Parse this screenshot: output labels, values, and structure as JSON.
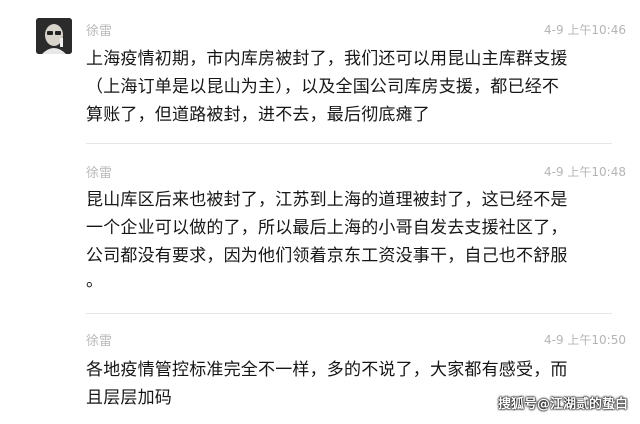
{
  "messages": [
    {
      "name": "徐雷",
      "time": "4-9 上午10:46",
      "lines": [
        "上海疫情初期，市内库房被封了，我们还可以用昆山主库群支援",
        "（上海订单是以昆山为主），以及全国公司库房支援，都已经不",
        "算账了，但道路被封，进不去，最后彻底瘫了"
      ]
    },
    {
      "name": "徐雷",
      "time": "4-9 上午10:48",
      "lines": [
        "昆山库区后来也被封了，江苏到上海的道理被封了，这已经不是",
        "一个企业可以做的了，所以最后上海的小哥自发去支援社区了，",
        "公司都没有要求，因为他们领着京东工资没事干，自己也不舒服",
        "。"
      ]
    },
    {
      "name": "徐雷",
      "time": "4-9 上午10:50",
      "lines": [
        "各地疫情管控标准完全不一样，多的不说了，大家都有感受，而",
        "且层层加码"
      ]
    }
  ],
  "watermark": "搜狐号@江湖贰的蛰白"
}
